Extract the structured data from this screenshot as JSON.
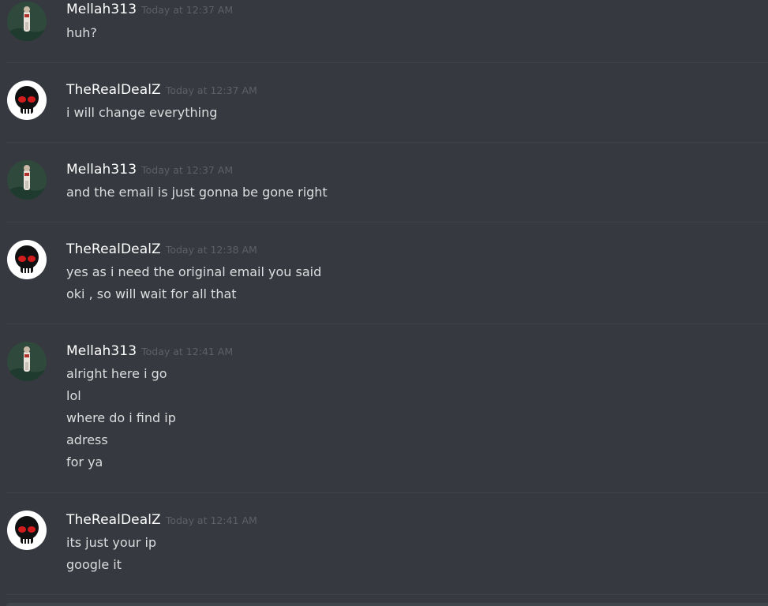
{
  "messages": [
    {
      "username": "Mellah313",
      "timestamp": "Today at 12:37 AM",
      "avatar": "mellah-avatar",
      "lines": [
        "huh?"
      ]
    },
    {
      "username": "TheRealDealZ",
      "timestamp": "Today at 12:37 AM",
      "avatar": "skull-avatar",
      "lines": [
        "i will change everything"
      ]
    },
    {
      "username": "Mellah313",
      "timestamp": "Today at 12:37 AM",
      "avatar": "mellah-avatar",
      "lines": [
        "and the email is just gonna be gone right"
      ]
    },
    {
      "username": "TheRealDealZ",
      "timestamp": "Today at 12:38 AM",
      "avatar": "skull-avatar",
      "lines": [
        "yes as i need the original email you said",
        "oki , so will wait for all that"
      ]
    },
    {
      "username": "Mellah313",
      "timestamp": "Today at 12:41 AM",
      "avatar": "mellah-avatar",
      "lines": [
        "alright here i go",
        "lol",
        "where do i find ip",
        "adress",
        "for ya"
      ]
    },
    {
      "username": "TheRealDealZ",
      "timestamp": "Today at 12:41 AM",
      "avatar": "skull-avatar",
      "lines": [
        "its just your ip",
        "google it"
      ]
    }
  ],
  "colors": {
    "background": "#36393f",
    "username": "#ffffff",
    "message_text": "#dcddde",
    "timestamp": "#5d6067",
    "divider": "#3f4248"
  }
}
